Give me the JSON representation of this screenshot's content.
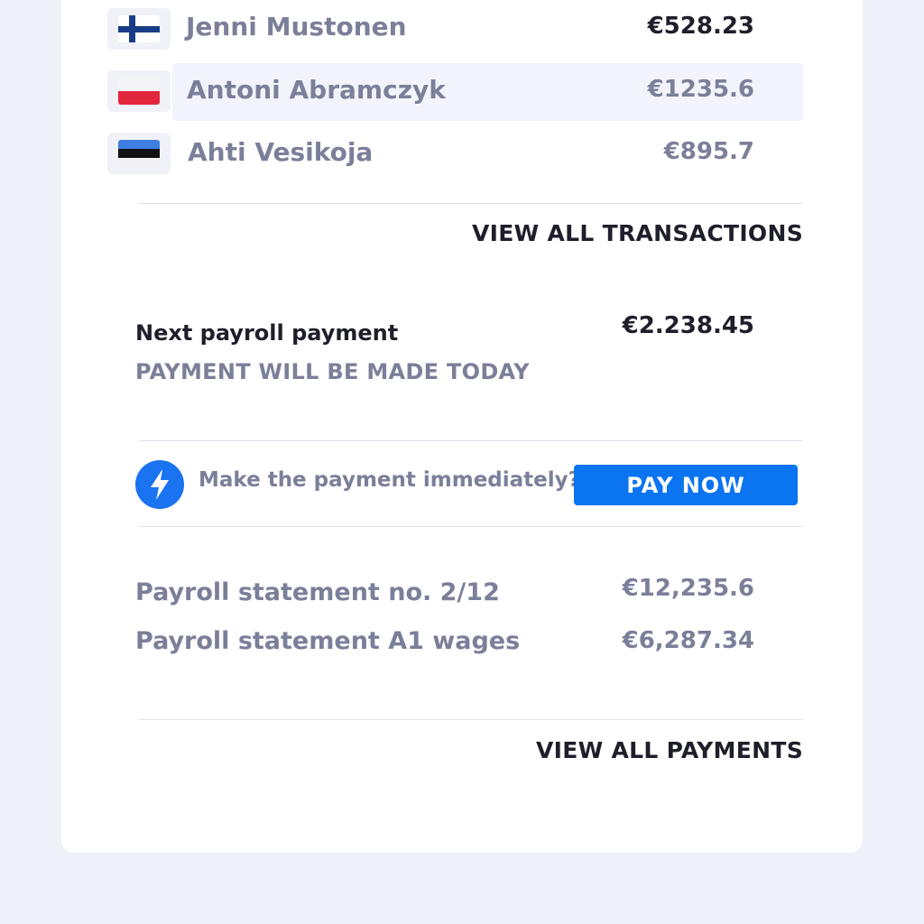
{
  "transactions": [
    {
      "name": "Jenni Mustonen",
      "amount": "€528.23",
      "flag": "finland-flag"
    },
    {
      "name": "Antoni Abramczyk",
      "amount": "€1235.6",
      "flag": "poland-flag"
    },
    {
      "name": "Ahti Vesikoja",
      "amount": "€895.7",
      "flag": "estonia-flag"
    }
  ],
  "view_all_transactions": "VIEW ALL TRANSACTIONS",
  "payroll": {
    "title": "Next payroll payment",
    "subtitle": "PAYMENT WILL BE MADE TODAY",
    "amount": "€2.238.45"
  },
  "pay_prompt": {
    "question": "Make the payment immediately?",
    "button": "PAY NOW",
    "icon": "lightning-bolt-icon"
  },
  "statements": [
    {
      "label": "Payroll statement no. 2/12",
      "amount": "€12,235.6"
    },
    {
      "label": "Payroll statement A1 wages",
      "amount": "€6,287.34"
    }
  ],
  "view_all_payments": "VIEW ALL PAYMENTS",
  "colors": {
    "page_bg": "#eff1f9",
    "card_bg": "#ffffff",
    "accent": "#0b74f1",
    "muted_text": "#7b7f99",
    "dark_text": "#1f1f2b"
  }
}
